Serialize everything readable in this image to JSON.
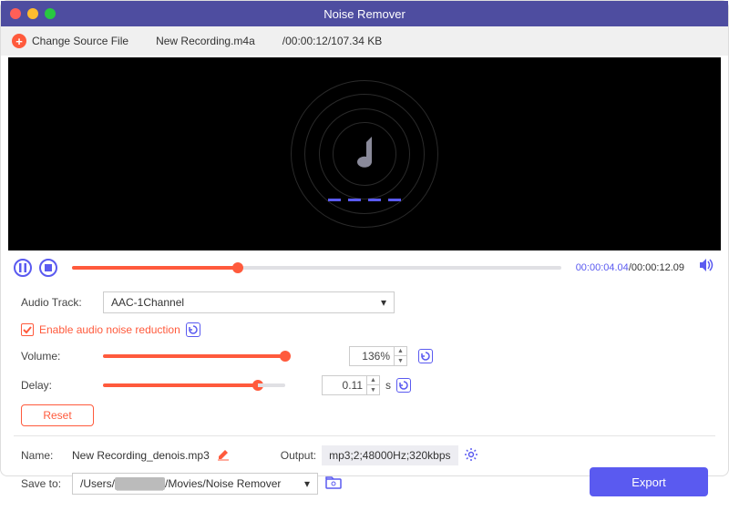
{
  "window": {
    "title": "Noise Remover"
  },
  "source": {
    "change_label": "Change Source File",
    "filename": "New Recording.m4a",
    "info": "/00:00:12/107.34 KB"
  },
  "transport": {
    "current_time": "00:00:04.04",
    "total_time": "00:00:12.09",
    "seek_percent": 34
  },
  "options": {
    "audio_track_label": "Audio Track:",
    "audio_track_value": "AAC-1Channel",
    "enable_noise_label": "Enable audio noise reduction",
    "volume_label": "Volume:",
    "volume_value": "136%",
    "delay_label": "Delay:",
    "delay_value": "0.11",
    "delay_unit": "s",
    "reset_label": "Reset"
  },
  "output": {
    "name_label": "Name:",
    "name_value": "New Recording_denois.mp3",
    "output_label": "Output:",
    "output_value": "mp3;2;48000Hz;320kbps",
    "save_label": "Save to:",
    "save_path_prefix": "/Users/",
    "save_path_masked": "██████",
    "save_path_suffix": "/Movies/Noise Remover",
    "export_label": "Export"
  }
}
